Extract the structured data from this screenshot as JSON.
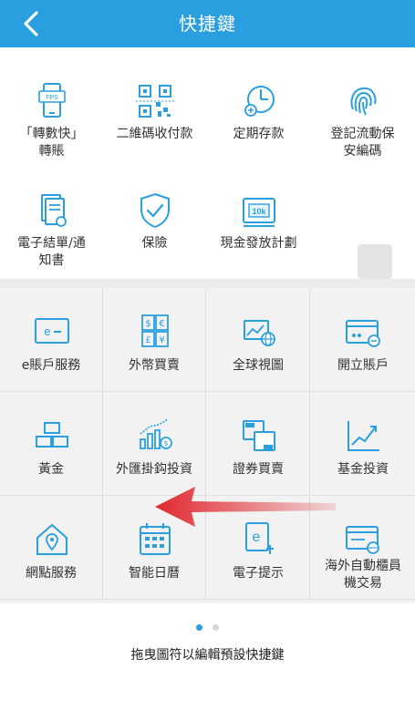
{
  "header": {
    "title": "快捷鍵",
    "back_icon": "chevron-left-icon",
    "bg_color": "#2a9fe0"
  },
  "shortcuts": [
    {
      "label": "「轉數快」\n轉賬",
      "icon": "fps-phone-icon"
    },
    {
      "label": "二維碼收付款",
      "icon": "qr-code-icon"
    },
    {
      "label": "定期存款",
      "icon": "time-deposit-icon"
    },
    {
      "label": "登記流動保\n安編碼",
      "icon": "fingerprint-icon"
    },
    {
      "label": "電子結單/通\n知書",
      "icon": "e-statement-icon"
    },
    {
      "label": "保險",
      "icon": "shield-check-icon"
    },
    {
      "label": "現金發放計劃",
      "icon": "cash-payout-icon"
    },
    {
      "label": "",
      "icon": "empty-slot"
    }
  ],
  "grid": [
    {
      "label": "e賬戶服務",
      "icon": "e-account-icon"
    },
    {
      "label": "外幣買賣",
      "icon": "currency-exchange-icon"
    },
    {
      "label": "全球視圖",
      "icon": "global-view-icon"
    },
    {
      "label": "開立賬戶",
      "icon": "open-account-icon"
    },
    {
      "label": "黃金",
      "icon": "gold-bars-icon"
    },
    {
      "label": "外匯掛鈎投資",
      "icon": "fx-linked-investment-icon"
    },
    {
      "label": "證券買賣",
      "icon": "securities-trading-icon"
    },
    {
      "label": "基金投資",
      "icon": "fund-investment-icon"
    },
    {
      "label": "網點服務",
      "icon": "branch-location-icon"
    },
    {
      "label": "智能日曆",
      "icon": "smart-calendar-icon"
    },
    {
      "label": "電子提示",
      "icon": "e-alert-icon"
    },
    {
      "label": "海外自動櫃員\n機交易",
      "icon": "overseas-atm-icon"
    }
  ],
  "pagination": {
    "current": 1,
    "total": 2
  },
  "footer": {
    "hint": "拖曳圖符以編輯預設快捷鍵"
  },
  "colors": {
    "icon_blue": "#2a9fe0",
    "arrow_red": "#e0282e"
  }
}
